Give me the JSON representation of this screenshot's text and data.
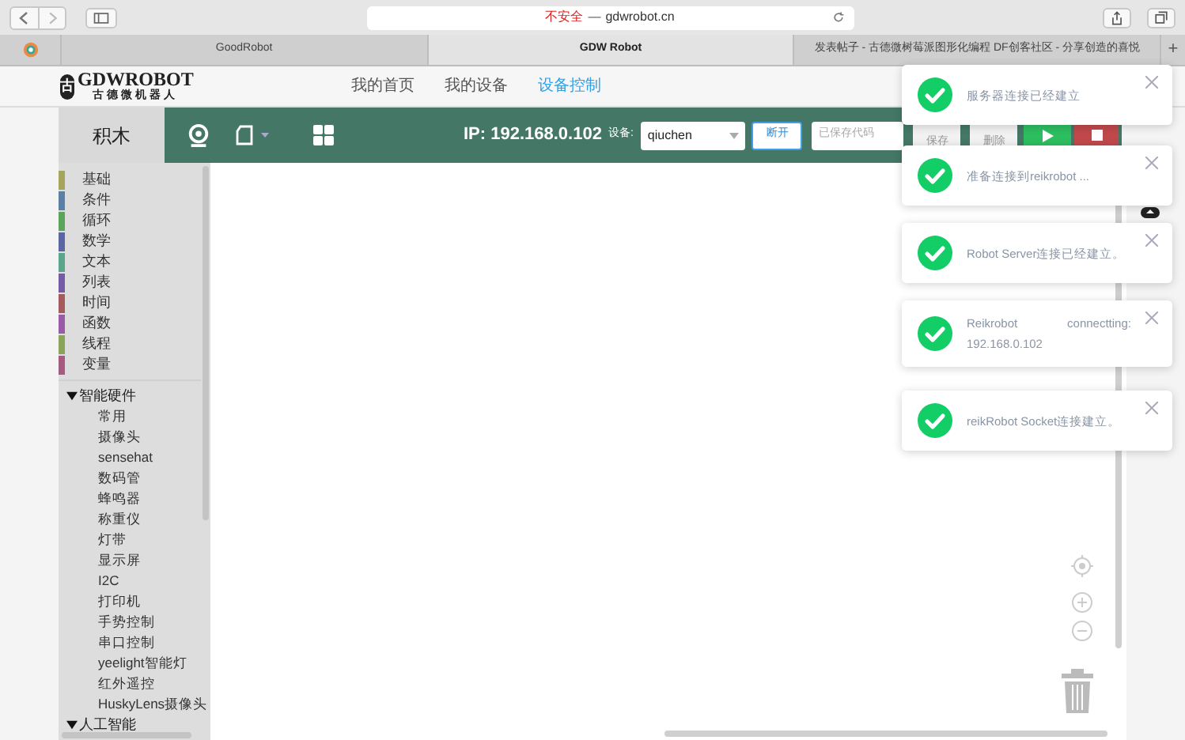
{
  "browser": {
    "security": "不安全",
    "separator": "—",
    "url": "gdwrobot.cn",
    "new_tab": "+",
    "tabs": [
      {
        "title": "GoodRobot",
        "selected": false
      },
      {
        "title": "GDW Robot",
        "selected": true
      },
      {
        "title": "发表帖子 - 古德微树莓派图形化编程 DF创客社区 - 分享创造的喜悦",
        "selected": false
      }
    ]
  },
  "logo": {
    "mark": "古",
    "name": "GDWROBOT",
    "subtitle": "古德微机器人"
  },
  "nav": [
    {
      "label": "我的首页",
      "selected": false
    },
    {
      "label": "我的设备",
      "selected": false
    },
    {
      "label": "设备控制",
      "selected": true
    }
  ],
  "toolbar": {
    "blocks_tab": "积木",
    "ip": "IP: 192.168.0.102",
    "device_label": "设备:",
    "device": "qiuchen",
    "disconnect": "断开",
    "saved_code_placeholder": "已保存代码",
    "save": "保存",
    "delete": "删除"
  },
  "categories": [
    {
      "label": "基础",
      "color": "#a5a55b"
    },
    {
      "label": "条件",
      "color": "#5b80a5"
    },
    {
      "label": "循环",
      "color": "#5ba55b"
    },
    {
      "label": "数学",
      "color": "#5b67a5"
    },
    {
      "label": "文本",
      "color": "#5ba58c"
    },
    {
      "label": "列表",
      "color": "#745ba5"
    },
    {
      "label": "时间",
      "color": "#a55b5b"
    },
    {
      "label": "函数",
      "color": "#995ba5"
    },
    {
      "label": "线程",
      "color": "#8aa55b"
    },
    {
      "label": "变量",
      "color": "#a55b80"
    }
  ],
  "groups": [
    {
      "label": "智能硬件",
      "expanded": true,
      "children": [
        {
          "label": "常用"
        },
        {
          "label": "摄像头"
        },
        {
          "label": "sensehat"
        },
        {
          "label": "数码管"
        },
        {
          "label": "蜂鸣器"
        },
        {
          "label": "称重仪"
        },
        {
          "label": "灯带"
        },
        {
          "label": "显示屏"
        },
        {
          "label": "I2C"
        },
        {
          "label": "打印机"
        },
        {
          "label": "手势控制"
        },
        {
          "label": "串口控制"
        },
        {
          "label": "yeelight智能灯"
        },
        {
          "label": "红外遥控"
        },
        {
          "label": "HuskyLens摄像头"
        }
      ]
    },
    {
      "label": "人工智能",
      "expanded": true
    }
  ],
  "toasts": [
    {
      "message": "服务器连接已经建立"
    },
    {
      "message": "准备连接到reikrobot ..."
    },
    {
      "message": "Robot Server连接已经建立。"
    },
    {
      "message": "Reikrobot connectting: 192.168.0.102"
    },
    {
      "message": "reikRobot Socket连接建立。"
    }
  ]
}
